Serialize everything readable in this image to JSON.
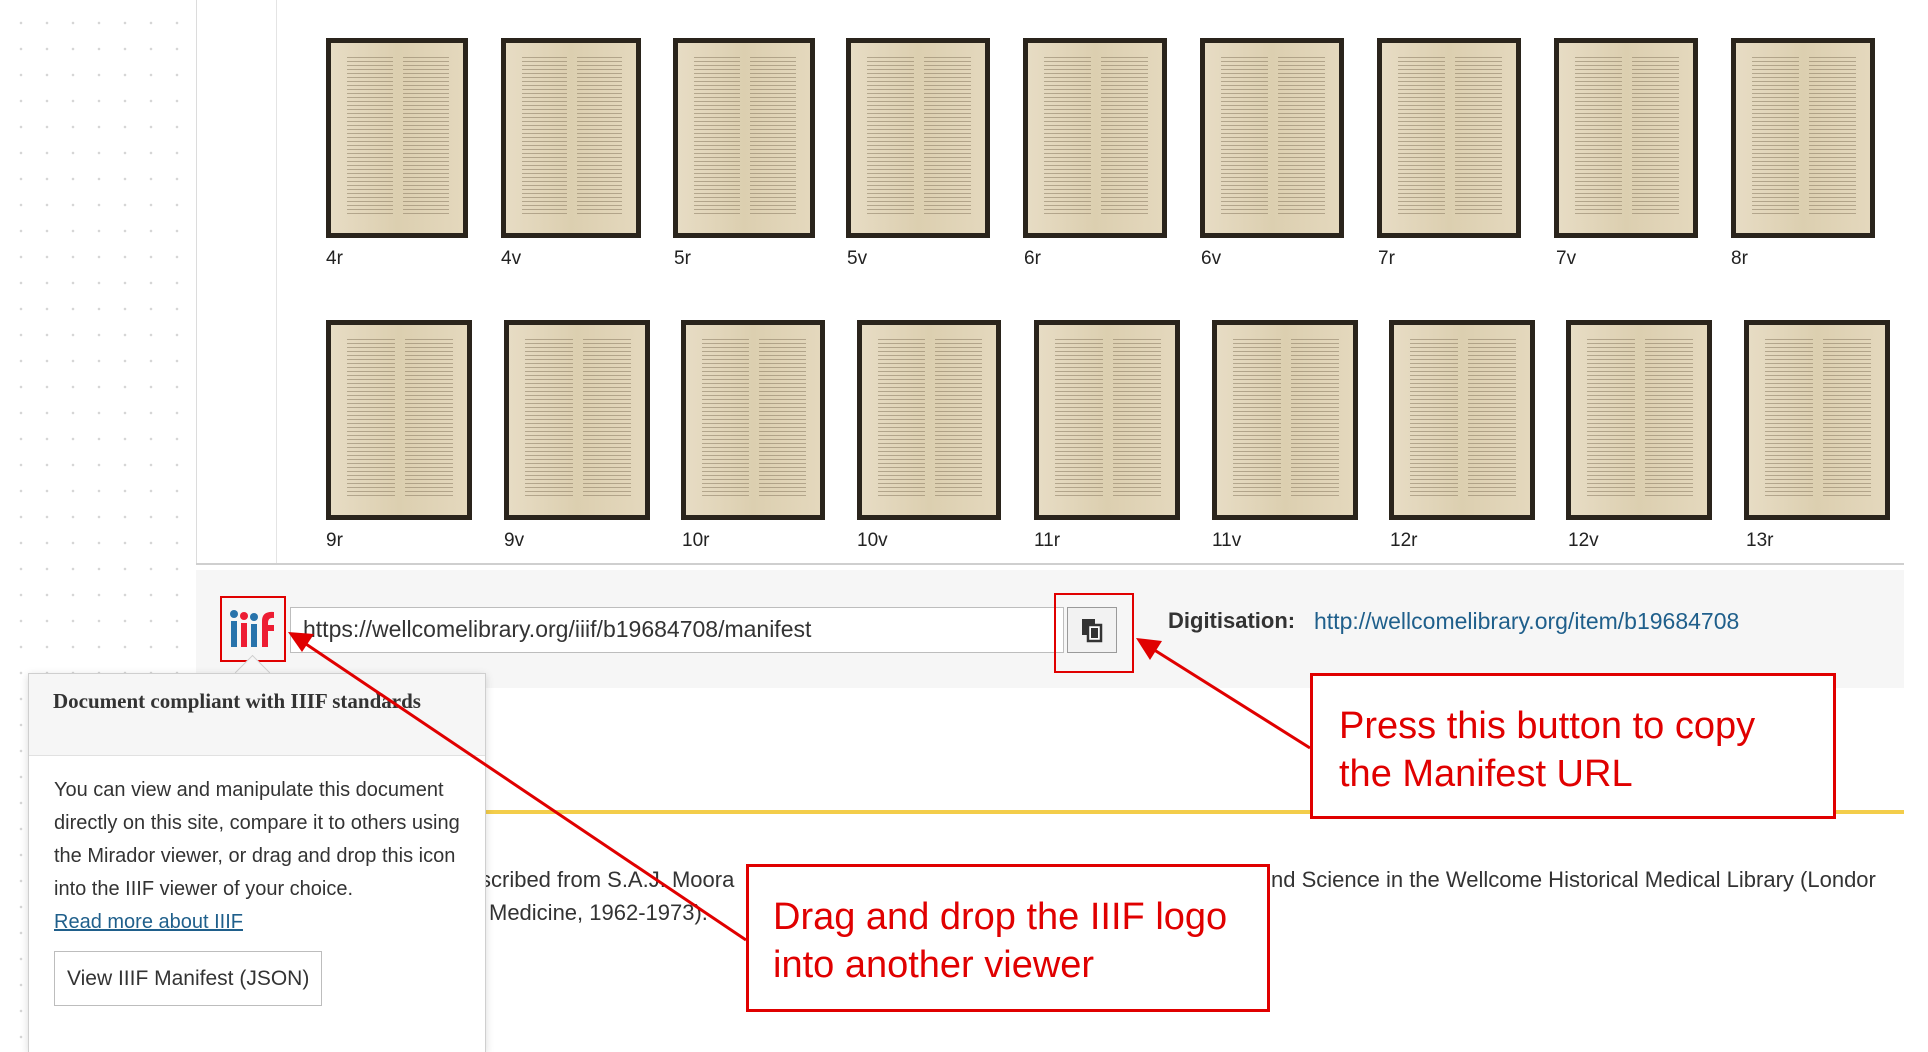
{
  "thumbnails_row1": [
    {
      "label": "4r"
    },
    {
      "label": "4v"
    },
    {
      "label": "5r"
    },
    {
      "label": "5v"
    },
    {
      "label": "6r"
    },
    {
      "label": "6v"
    },
    {
      "label": "7r"
    },
    {
      "label": "7v"
    },
    {
      "label": "8r"
    }
  ],
  "thumbnails_row2": [
    {
      "label": "9r"
    },
    {
      "label": "9v"
    },
    {
      "label": "10r"
    },
    {
      "label": "10v"
    },
    {
      "label": "11r"
    },
    {
      "label": "11v"
    },
    {
      "label": "12r"
    },
    {
      "label": "12v"
    },
    {
      "label": "13r"
    }
  ],
  "iiif_bar": {
    "logo_text": "iiif",
    "manifest_url": "https://wellcomelibrary.org/iiif/b19684708/manifest",
    "copy_icon": "copy-icon",
    "digitisation_label": "Digitisation:",
    "digitisation_link": "http://wellcomelibrary.org/item/b19684708"
  },
  "description": {
    "line1_left": "scribed from S.A.J. Moora",
    "line1_right": "nd Science in the Wellcome Historical Medical Library (Londor",
    "line2": "Medicine, 1962-1973)."
  },
  "popover": {
    "title": "Document compliant with IIIF standards",
    "body": "You can view and manipulate this document directly on this site, compare it to others using the Mirador viewer, or drag and drop this icon into the IIIF viewer of your choice.",
    "link": "Read more about IIIF",
    "button": "View IIIF Manifest (JSON)"
  },
  "callouts": {
    "copy": "Press this button to copy the Manifest URL",
    "drag": "Drag and drop the IIIF logo into another viewer"
  },
  "colors": {
    "annotation_red": "#e00000",
    "link_blue": "#1f5f8b",
    "accent_yellow": "#f3cd4a"
  }
}
